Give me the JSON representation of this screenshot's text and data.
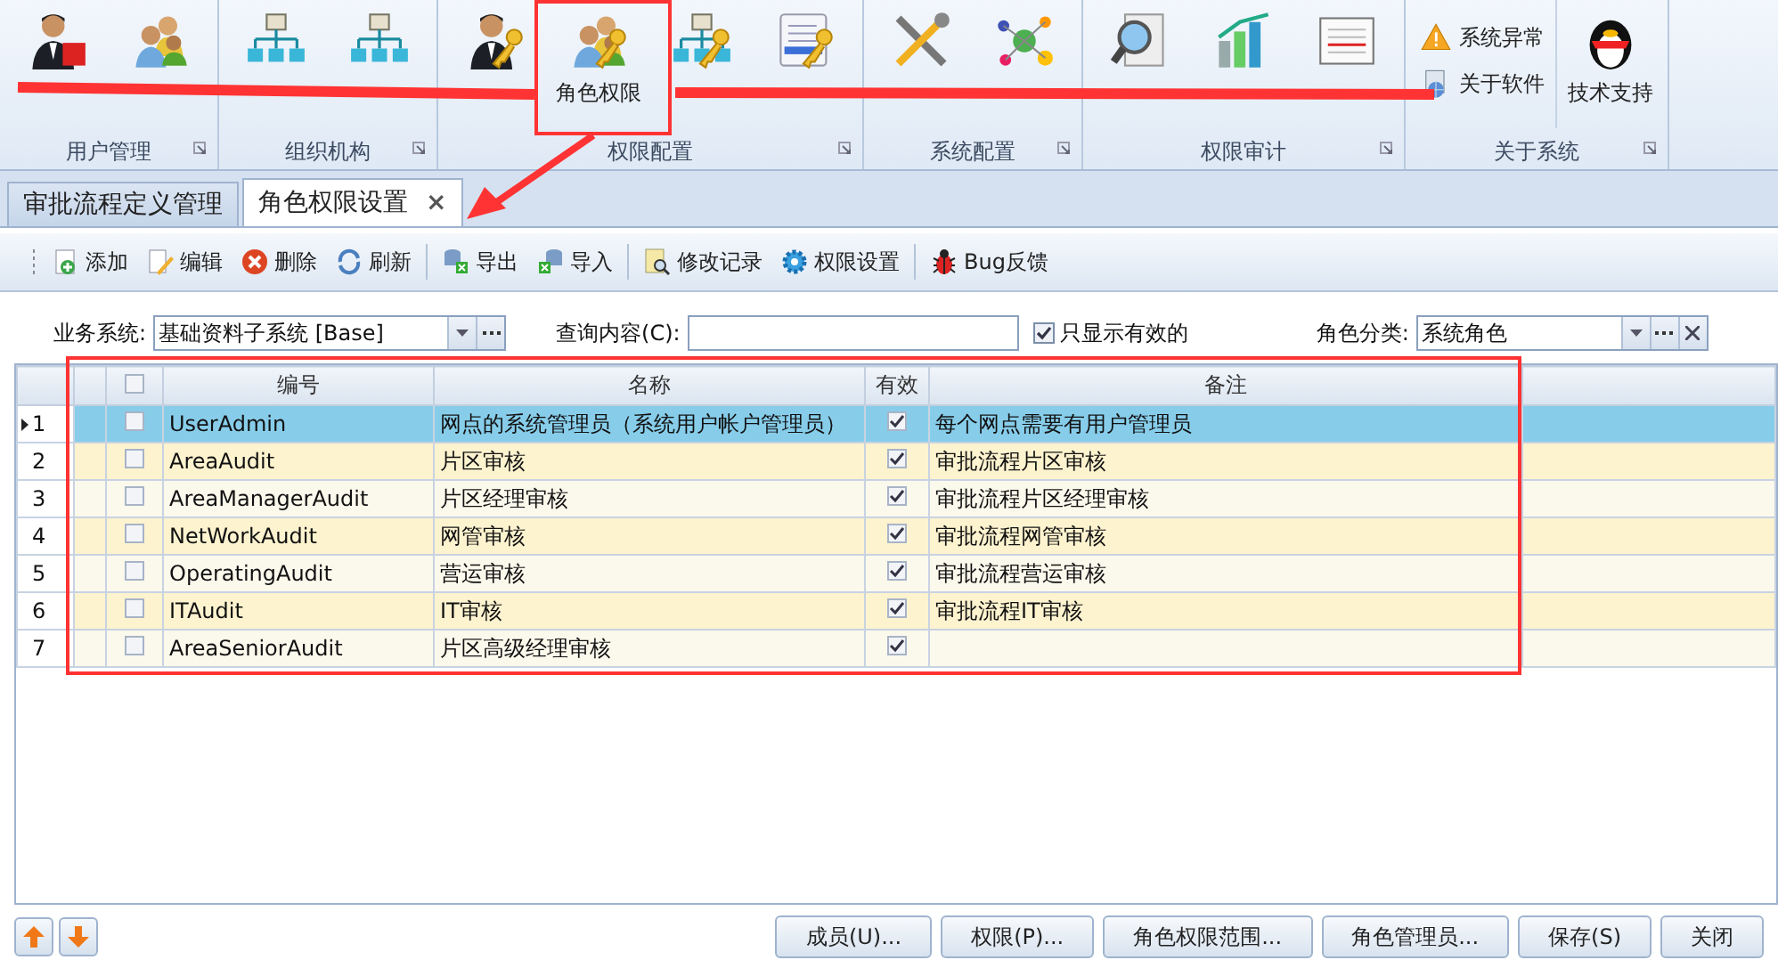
{
  "ribbon": {
    "groups": [
      {
        "label": "用户管理",
        "buttons": [
          {
            "kind": "large"
          },
          {
            "kind": "large"
          }
        ]
      },
      {
        "label": "组织机构",
        "buttons": [
          {
            "kind": "large"
          },
          {
            "kind": "large"
          }
        ]
      },
      {
        "label": "权限配置",
        "buttons": [
          {
            "kind": "large"
          },
          {
            "label": "角色权限",
            "kind": "large"
          },
          {
            "kind": "large"
          },
          {
            "kind": "large"
          }
        ]
      },
      {
        "label": "系统配置",
        "buttons": [
          {
            "kind": "large"
          },
          {
            "kind": "large"
          }
        ]
      },
      {
        "label": "权限审计",
        "buttons": [
          {
            "kind": "large"
          },
          {
            "kind": "large"
          },
          {
            "kind": "large"
          }
        ]
      },
      {
        "label": "关于系统",
        "buttons": [
          {
            "label": "系统异常",
            "kind": "small"
          },
          {
            "label": "关于软件",
            "kind": "small"
          },
          {
            "label": "技术支持",
            "kind": "large"
          }
        ]
      }
    ]
  },
  "tabs": [
    {
      "label": "审批流程定义管理",
      "selected": false
    },
    {
      "label": "角色权限设置",
      "selected": true,
      "close": "×"
    }
  ],
  "toolbar": [
    {
      "kind": "button",
      "label": "添加"
    },
    {
      "kind": "button",
      "label": "编辑"
    },
    {
      "kind": "button",
      "label": "删除"
    },
    {
      "kind": "button",
      "label": "刷新"
    },
    {
      "kind": "separator"
    },
    {
      "kind": "button",
      "label": "导出"
    },
    {
      "kind": "button",
      "label": "导入"
    },
    {
      "kind": "separator"
    },
    {
      "kind": "button",
      "label": "修改记录"
    },
    {
      "kind": "button",
      "label": "权限设置"
    },
    {
      "kind": "separator"
    },
    {
      "kind": "button",
      "label": "Bug反馈"
    }
  ],
  "filters": {
    "business_system": {
      "label": "业务系统:",
      "value": "基础资料子系统 [Base]"
    },
    "query": {
      "label": "查询内容(C):"
    },
    "only_valid": {
      "label": "只显示有效的",
      "checked": true
    },
    "role_category": {
      "label": "角色分类:",
      "value": "系统角色"
    }
  },
  "table": {
    "header_checked": false,
    "columns": [
      "编号",
      "名称",
      "有效",
      "备注"
    ],
    "rows": [
      {
        "number": "1",
        "selected": true,
        "checked": false,
        "code": "UserAdmin",
        "name": "网点的系统管理员（系统用户帐户管理员）",
        "valid": true,
        "note": "每个网点需要有用户管理员"
      },
      {
        "number": "2",
        "selected": false,
        "checked": false,
        "code": "AreaAudit",
        "name": "片区审核",
        "valid": true,
        "note": "审批流程片区审核"
      },
      {
        "number": "3",
        "selected": false,
        "checked": false,
        "code": "AreaManagerAudit",
        "name": "片区经理审核",
        "valid": true,
        "note": "审批流程片区经理审核"
      },
      {
        "number": "4",
        "selected": false,
        "checked": false,
        "code": "NetWorkAudit",
        "name": "网管审核",
        "valid": true,
        "note": "审批流程网管审核"
      },
      {
        "number": "5",
        "selected": false,
        "checked": false,
        "code": "OperatingAudit",
        "name": "营运审核",
        "valid": true,
        "note": "审批流程营运审核"
      },
      {
        "number": "6",
        "selected": false,
        "checked": false,
        "code": "ITAudit",
        "name": "IT审核",
        "valid": true,
        "note": "审批流程IT审核"
      },
      {
        "number": "7",
        "selected": false,
        "checked": false,
        "code": "AreaSeniorAudit",
        "name": "片区高级经理审核",
        "valid": true
      }
    ]
  },
  "buttons": [
    "成员(U)...",
    "权限(P)...",
    "角色权限范围...",
    "角色管理员...",
    "保存(S)",
    "关闭"
  ]
}
